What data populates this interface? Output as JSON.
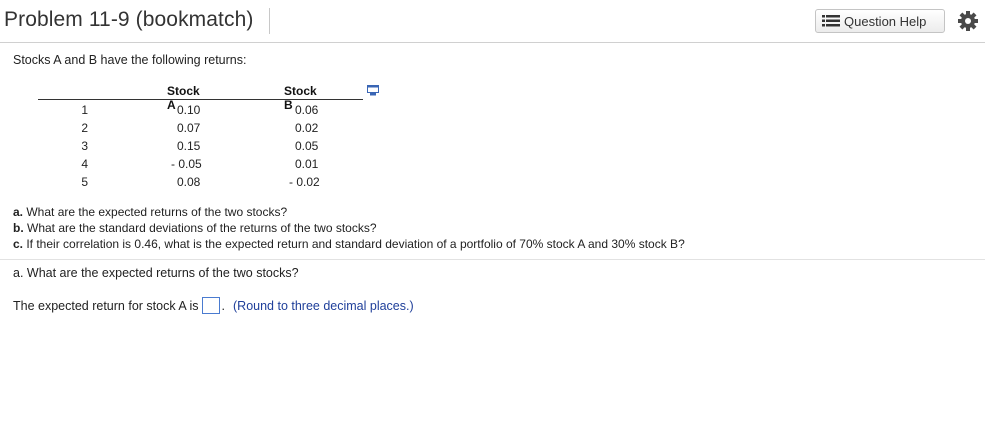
{
  "header": {
    "title": "Problem 11-9 (bookmatch)",
    "question_help_label": "Question Help"
  },
  "intro": "Stocks A and B have the following returns:",
  "table": {
    "headers": [
      "Stock A",
      "Stock B"
    ],
    "rows": [
      {
        "label": "1",
        "a": "0.10",
        "b": "0.06"
      },
      {
        "label": "2",
        "a": "0.07",
        "b": "0.02"
      },
      {
        "label": "3",
        "a": "0.15",
        "b": "0.05"
      },
      {
        "label": "4",
        "a": "- 0.05",
        "b": "0.01"
      },
      {
        "label": "5",
        "a": "0.08",
        "b": "- 0.02"
      }
    ]
  },
  "questions": [
    {
      "letter": "a.",
      "text": " What are the expected returns of the two stocks?"
    },
    {
      "letter": "b.",
      "text": " What are the standard deviations of the returns of the two stocks?"
    },
    {
      "letter": "c.",
      "text": " If their correlation is 0.46, what is the expected return and standard deviation of a portfolio of 70% stock A and 30% stock B?"
    }
  ],
  "part_a": "a. What are the expected returns of the two stocks?",
  "answer": {
    "prefix": "The expected return for stock A is",
    "suffix": ".",
    "value": "",
    "hint": "(Round to three decimal places.)"
  },
  "colors": {
    "accent": "#1f3f9a",
    "input_border": "#4a7bd0"
  }
}
